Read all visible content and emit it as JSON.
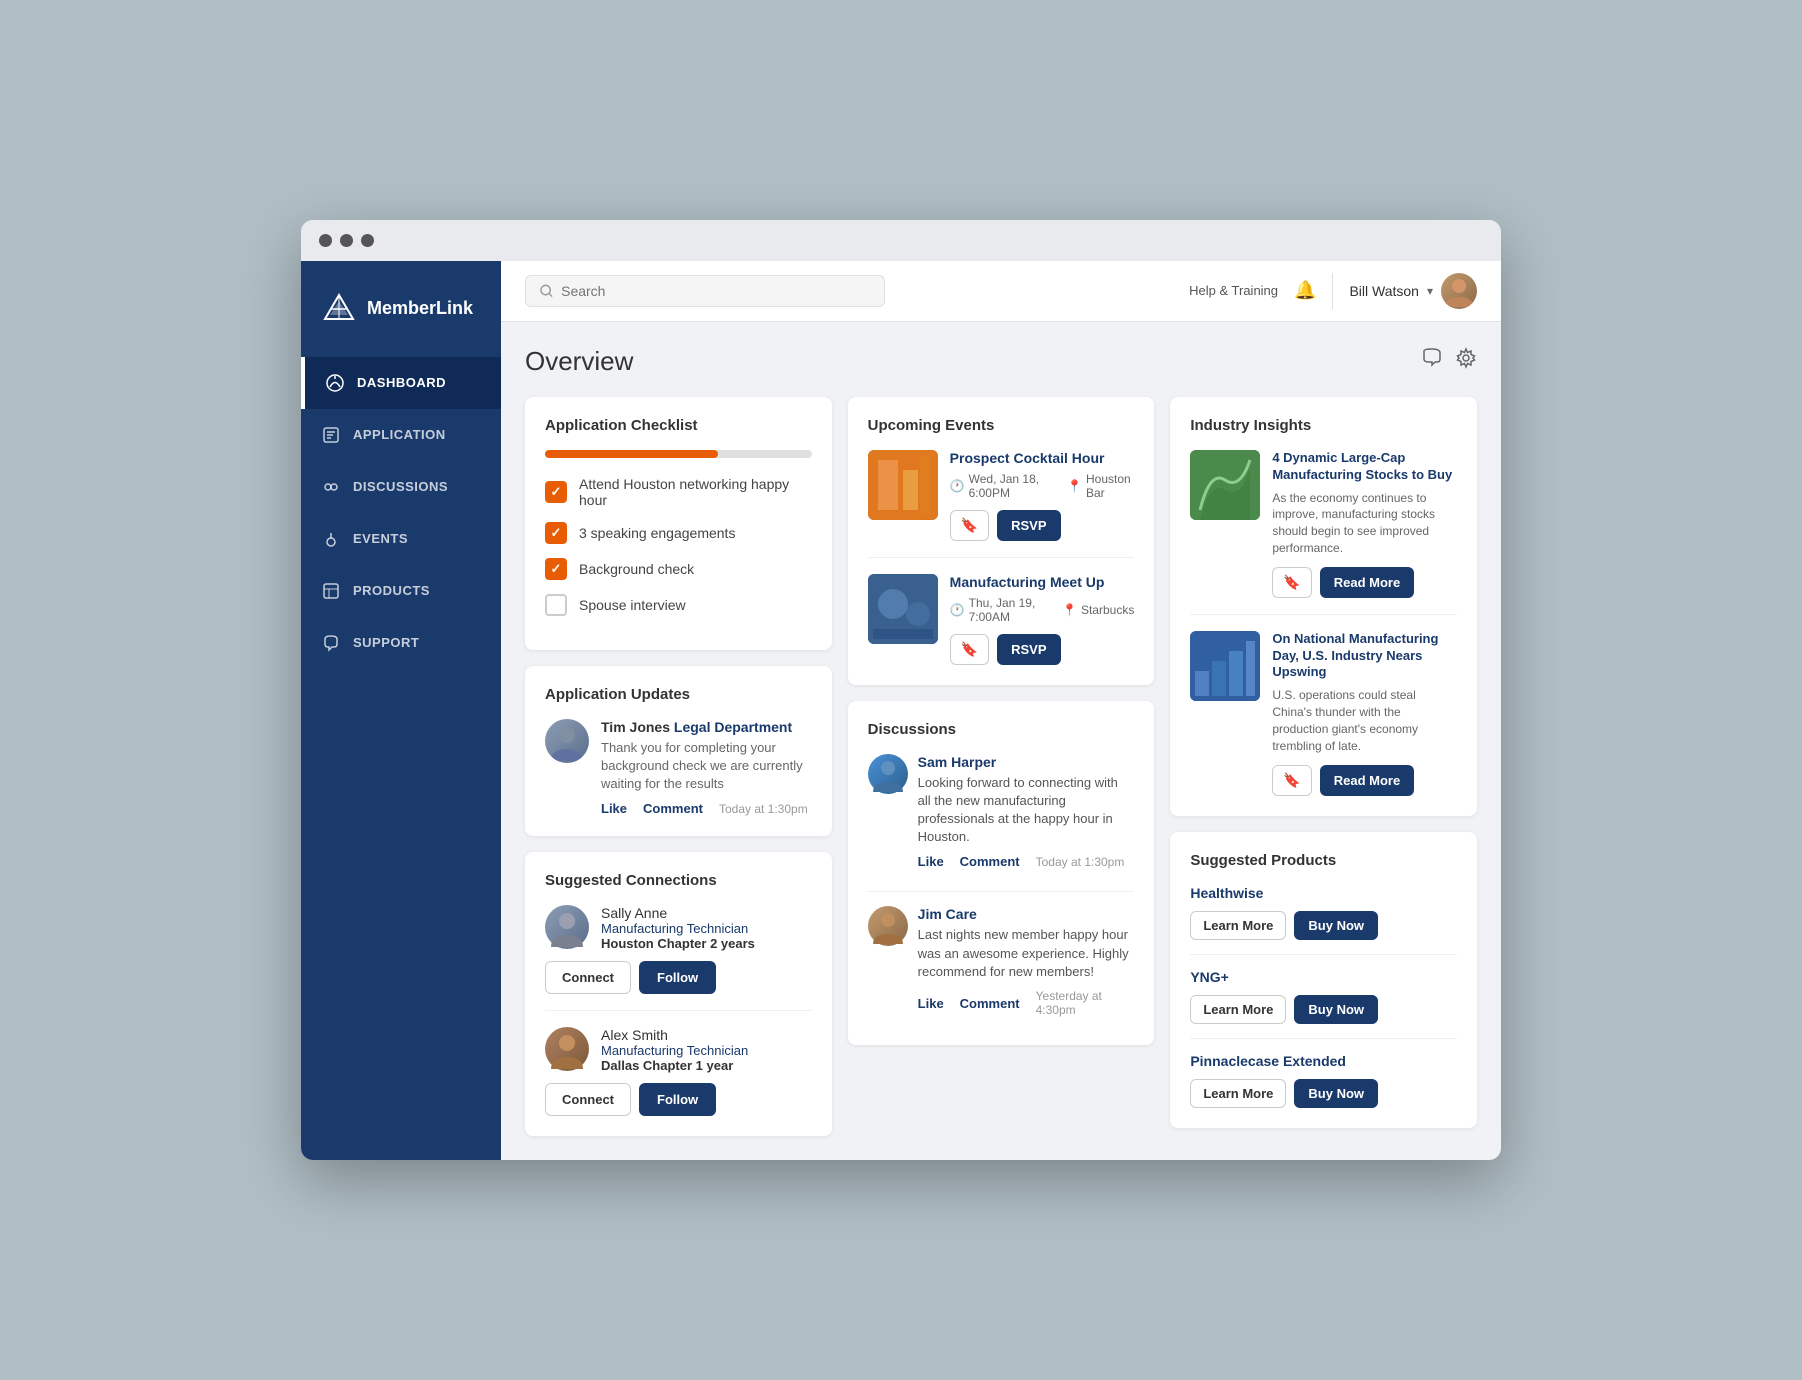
{
  "window": {
    "dots": [
      "dot1",
      "dot2",
      "dot3"
    ]
  },
  "sidebar": {
    "logo": {
      "text": "MemberLink"
    },
    "items": [
      {
        "id": "dashboard",
        "label": "DASHBOARD",
        "icon": "◈",
        "active": true
      },
      {
        "id": "application",
        "label": "APPLICATION",
        "icon": "⊞"
      },
      {
        "id": "discussions",
        "label": "DISCUSSIONS",
        "icon": "👥"
      },
      {
        "id": "events",
        "label": "EVENTS",
        "icon": "📍"
      },
      {
        "id": "products",
        "label": "PRODUCTS",
        "icon": "📋"
      },
      {
        "id": "support",
        "label": "SUPPORT",
        "icon": "💬"
      }
    ]
  },
  "topbar": {
    "search_placeholder": "Search",
    "help_label": "Help & Training",
    "user_name": "Bill Watson"
  },
  "page": {
    "title": "Overview"
  },
  "application_checklist": {
    "title": "Application Checklist",
    "progress_percent": 65,
    "items": [
      {
        "id": "item1",
        "checked": true,
        "text": "Attend Houston networking happy hour"
      },
      {
        "id": "item2",
        "checked": true,
        "text": "3 speaking engagements"
      },
      {
        "id": "item3",
        "checked": true,
        "text": "Background check"
      },
      {
        "id": "item4",
        "checked": false,
        "text": "Spouse interview"
      }
    ]
  },
  "application_updates": {
    "title": "Application Updates",
    "author_name": "Tim Jones",
    "author_dept": "Legal Department",
    "message": "Thank you for completing your background check we are currently waiting for the results",
    "like_label": "Like",
    "comment_label": "Comment",
    "timestamp": "Today at 1:30pm"
  },
  "suggested_connections": {
    "title": "Suggested Connections",
    "connections": [
      {
        "id": "conn1",
        "first_name": "Sally Anne",
        "last_name": "",
        "role": "Manufacturing Technician",
        "chapter": "Houston Chapter",
        "tenure": "2 years",
        "connect_label": "Connect",
        "follow_label": "Follow"
      },
      {
        "id": "conn2",
        "first_name": "Alex Smith",
        "last_name": "",
        "role": "Manufacturing Technician",
        "chapter": "Dallas Chapter",
        "tenure": "1 year",
        "connect_label": "Connect",
        "follow_label": "Follow"
      }
    ]
  },
  "upcoming_events": {
    "title": "Upcoming Events",
    "events": [
      {
        "id": "ev1",
        "title": "Prospect Cocktail Hour",
        "date": "Wed, Jan 18, 6:00PM",
        "location": "Houston Bar",
        "rsvp_label": "RSVP"
      },
      {
        "id": "ev2",
        "title": "Manufacturing Meet Up",
        "date": "Thu, Jan 19, 7:00AM",
        "location": "Starbucks",
        "rsvp_label": "RSVP"
      }
    ]
  },
  "discussions": {
    "title": "Discussions",
    "posts": [
      {
        "id": "disc1",
        "author": "Sam Harper",
        "text": "Looking forward to connecting with all the new manufacturing professionals at the happy hour in Houston.",
        "like_label": "Like",
        "comment_label": "Comment",
        "timestamp": "Today at 1:30pm"
      },
      {
        "id": "disc2",
        "author": "Jim Care",
        "text": "Last nights new member happy hour was an awesome experience. Highly recommend for new members!",
        "like_label": "Like",
        "comment_label": "Comment",
        "timestamp": "Yesterday at 4:30pm"
      }
    ]
  },
  "industry_insights": {
    "title": "Industry Insights",
    "items": [
      {
        "id": "ins1",
        "title": "4 Dynamic Large-Cap Manufacturing Stocks to Buy",
        "text": "As the economy continues to improve, manufacturing stocks should begin to see improved performance.",
        "read_more_label": "Read More"
      },
      {
        "id": "ins2",
        "title": "On National Manufacturing Day, U.S. Industry Nears Upswing",
        "text": "U.S. operations could steal China's thunder with the production giant's economy trembling of late.",
        "read_more_label": "Read More"
      }
    ]
  },
  "suggested_products": {
    "title": "Suggested Products",
    "products": [
      {
        "id": "prod1",
        "name": "Healthwise",
        "learn_more_label": "Learn More",
        "buy_now_label": "Buy Now"
      },
      {
        "id": "prod2",
        "name": "YNG+",
        "learn_more_label": "Learn More",
        "buy_now_label": "Buy Now"
      },
      {
        "id": "prod3",
        "name": "Pinnaclecase Extended",
        "learn_more_label": "Learn More",
        "buy_now_label": "Buy Now"
      }
    ]
  }
}
